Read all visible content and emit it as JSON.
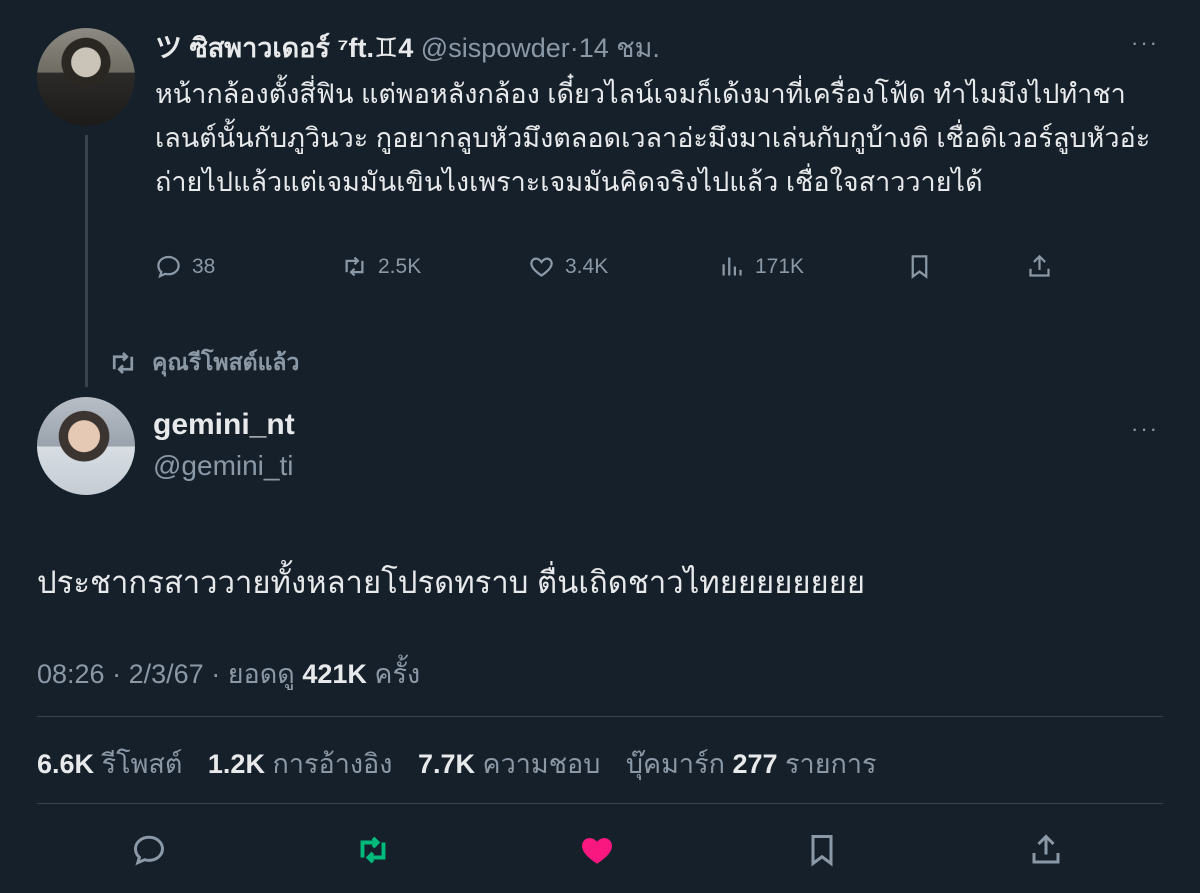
{
  "quoted_tweet": {
    "display_name": "ツ ซิสพาวเดอร์ ⁷ft.♊︎4",
    "handle": "@sispowder",
    "separator": "·",
    "time": "14 ชม.",
    "more": "···",
    "text": "หน้ากล้องตั้งสี่ฟิน แต่พอหลังกล้อง เดี๋ยวไลน์เจมก็เด้งมาที่เครื่องโฟ้ด ทำไมมึงไปทำชาเลนต์นั้นกับภูวินวะ กูอยากลูบหัวมึงตลอดเวลาอ่ะมึงมาเล่นกับกูบ้างดิ เชื่อดิเวอร์ลูบหัวอ่ะถ่ายไปแล้วแต่เจมมันเขินไงเพราะเจมมันคิดจริงไปแล้ว เชื่อใจสาววายได้",
    "actions": {
      "replies": "38",
      "retweets": "2.5K",
      "likes": "3.4K",
      "views": "171K"
    },
    "icons": [
      "reply-icon",
      "retweet-icon",
      "like-icon",
      "views-icon",
      "bookmark-icon",
      "share-icon"
    ]
  },
  "retweet_banner": {
    "label": "คุณรีโพสต์แล้ว",
    "icon": "retweet-icon"
  },
  "main_tweet": {
    "display_name": "gemini_nt",
    "handle": "@gemini_ti",
    "more": "···",
    "text": "ประชากรสาววายทั้งหลายโปรดทราบ ตื่นเถิดชาวไทยยยยยยยย",
    "time": "08:26",
    "date": "2/3/67",
    "views_label": "ยอดดู",
    "views_count": "421K",
    "views_suffix": "ครั้ง",
    "dot": "·",
    "stats": {
      "reposts_count": "6.6K",
      "reposts_label": "รีโพสต์",
      "quotes_count": "1.2K",
      "quotes_label": "การอ้างอิง",
      "likes_count": "7.7K",
      "likes_label": "ความชอบ",
      "bookmarks_label": "บุ๊คมาร์ก",
      "bookmarks_count": "277",
      "bookmarks_suffix": "รายการ"
    }
  },
  "colors": {
    "background": "#15202b",
    "text": "#e7e9ea",
    "muted": "#8b98a5",
    "divider": "#38444d",
    "retweet_active": "#00ba7c",
    "like_active": "#f91880"
  }
}
